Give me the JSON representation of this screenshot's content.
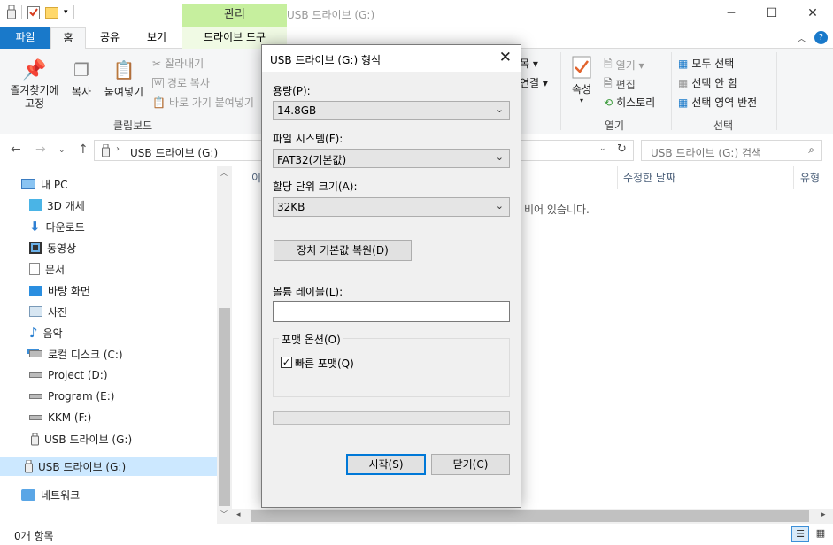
{
  "window": {
    "title": "USB 드라이브 (G:)",
    "manage_tab": "관리",
    "minimize": "─",
    "maximize": "☐",
    "close": "✕"
  },
  "ribbon_tabs": {
    "file": "파일",
    "home": "홈",
    "share": "공유",
    "view": "보기",
    "drive_tools": "드라이브 도구"
  },
  "ribbon": {
    "pin_label": "즐겨찾기에\n고정",
    "copy": "복사",
    "paste": "붙여넣기",
    "cut": "잘라내기",
    "copy_path": "경로 복사",
    "paste_shortcut": "바로 가기 붙여넣기",
    "clipboard_group": "클립보드",
    "new_item_partial": "목 ▾",
    "easy_access_partial": "연결 ▾",
    "properties": "속성",
    "open": "열기 ▾",
    "edit": "편집",
    "history": "히스토리",
    "open_group": "열기",
    "select_all": "모두 선택",
    "select_none": "선택 안 함",
    "invert_selection": "선택 영역 반전",
    "select_group": "선택"
  },
  "address": {
    "path": "USB 드라이브 (G:)",
    "search_placeholder": "USB 드라이브 (G:) 검색"
  },
  "nav": {
    "items": [
      {
        "label": "내 PC"
      },
      {
        "label": "3D 개체"
      },
      {
        "label": "다운로드"
      },
      {
        "label": "동영상"
      },
      {
        "label": "문서"
      },
      {
        "label": "바탕 화면"
      },
      {
        "label": "사진"
      },
      {
        "label": "음악"
      },
      {
        "label": "로컬 디스크 (C:)"
      },
      {
        "label": "Project (D:)"
      },
      {
        "label": "Program (E:)"
      },
      {
        "label": "KKM (F:)"
      },
      {
        "label": "USB 드라이브 (G:)"
      },
      {
        "label": "USB 드라이브 (G:)"
      },
      {
        "label": "네트워크"
      }
    ]
  },
  "content": {
    "col_name_partial": "이",
    "col_modified": "수정한 날짜",
    "col_type": "유형",
    "empty_message_partial": "비어 있습니다."
  },
  "status": {
    "item_count": "0개 항목"
  },
  "dialog": {
    "title": "USB 드라이브 (G:) 형식",
    "capacity_label": "용량(P):",
    "capacity_value": "14.8GB",
    "fs_label": "파일 시스템(F):",
    "fs_value": "FAT32(기본값)",
    "unit_label": "할당 단위 크기(A):",
    "unit_value": "32KB",
    "restore_button": "장치 기본값 복원(D)",
    "volume_label": "볼륨 레이블(L):",
    "volume_value": "",
    "options_group": "포맷 옵션(O)",
    "quick_format": "빠른 포맷(Q)",
    "quick_format_checked": true,
    "progress": 0,
    "start_button": "시작(S)",
    "close_button": "닫기(C)"
  }
}
